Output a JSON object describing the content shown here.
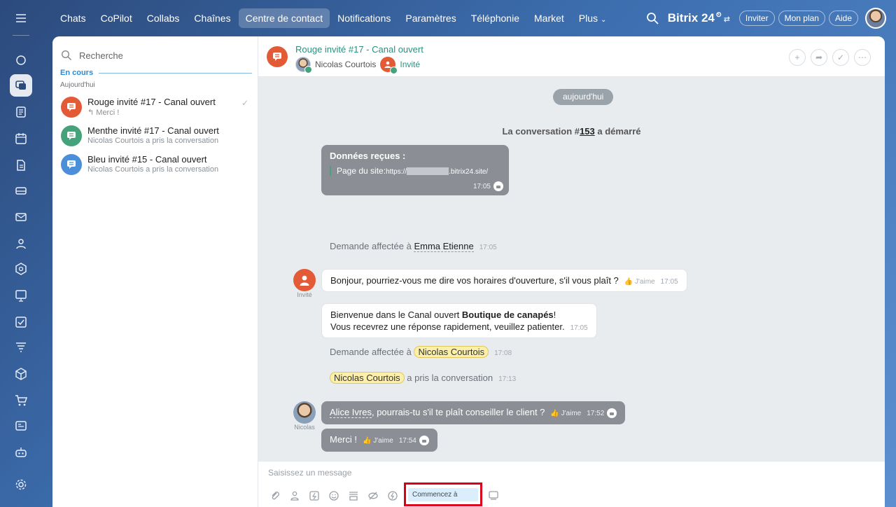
{
  "nav": {
    "tabs": [
      "Chats",
      "CoPilot",
      "Collabs",
      "Chaînes",
      "Centre de contact",
      "Notifications",
      "Paramètres",
      "Téléphonie",
      "Market",
      "Plus"
    ],
    "active_index": 4,
    "brand": "Bitrix 24",
    "buttons": {
      "invite": "Inviter",
      "plan": "Mon plan",
      "help": "Aide"
    }
  },
  "chatlist": {
    "search_placeholder": "Recherche",
    "section": "En cours",
    "day": "Aujourd'hui",
    "items": [
      {
        "title": "Rouge invité #17 - Canal ouvert",
        "subtitle": "Merci !",
        "color": "#e35a37"
      },
      {
        "title": "Menthe invité #17 - Canal ouvert",
        "subtitle": "Nicolas Courtois a pris la conversation",
        "color": "#45a37c"
      },
      {
        "title": "Bleu invité #15 - Canal ouvert",
        "subtitle": "Nicolas Courtois a pris la conversation",
        "color": "#4b8fd8"
      }
    ]
  },
  "header": {
    "title": "Rouge invité #17 - Canal ouvert",
    "member": "Nicolas Courtois",
    "guest": "Invité"
  },
  "messages": {
    "date": "aujourd'hui",
    "conv_started_prefix": "La conversation #",
    "conv_number": "153",
    "conv_started_suffix": " a démarré",
    "data_title": "Données reçues :",
    "data_site_label": "Page du site:",
    "data_site_url": "https://",
    "data_site_domain": ".bitrix24.site/",
    "data_time": "17:05",
    "assigned1_prefix": "Demande affectée à ",
    "assigned1_who": "Emma Etienne",
    "assigned1_time": "17:05",
    "guest_label": "Invité",
    "guest_msg": "Bonjour, pourriez-vous me dire vos horaires d'ouverture, s'il vous plaît ?",
    "guest_like": "J'aime",
    "guest_time": "17:05",
    "welcome_line1_prefix": "Bienvenue dans le Canal ouvert ",
    "welcome_line1_bold": "Boutique de canapés",
    "welcome_line1_suffix": "!",
    "welcome_line2": "Vous recevrez une réponse rapidement, veuillez patienter.",
    "welcome_time": "17:05",
    "assigned2_prefix": "Demande affectée à ",
    "assigned2_who": "Nicolas Courtois",
    "assigned2_time": "17:08",
    "took_who": "Nicolas Courtois",
    "took_text": " a pris la conversation",
    "took_time": "17:13",
    "agent_label": "Nicolas",
    "agent_mention": "Alice Ivres",
    "agent_msg": ", pourrais-tu s'il te plaît conseiller le client ?",
    "agent_like": "J'aime",
    "agent_time": "17:52",
    "merci": "Merci !",
    "merci_like": "J'aime",
    "merci_time": "17:54"
  },
  "composer": {
    "placeholder": "Saisissez un message",
    "start_button": "Commencez à"
  }
}
